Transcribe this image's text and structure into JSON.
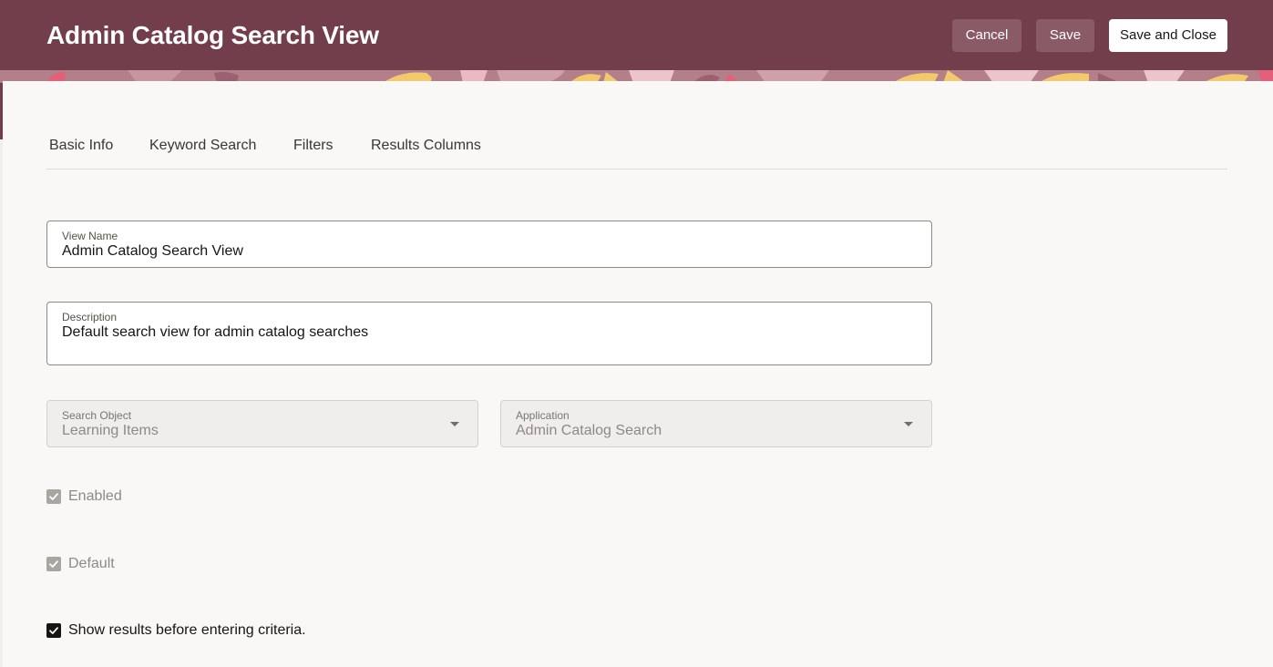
{
  "header": {
    "title": "Admin Catalog Search View",
    "cancel_label": "Cancel",
    "save_label": "Save",
    "save_close_label": "Save and Close"
  },
  "tabs": [
    {
      "label": "Basic Info"
    },
    {
      "label": "Keyword Search"
    },
    {
      "label": "Filters"
    },
    {
      "label": "Results Columns"
    }
  ],
  "form": {
    "view_name": {
      "label": "View Name",
      "value": "Admin Catalog Search View"
    },
    "description": {
      "label": "Description",
      "value": "Default search view for admin catalog searches"
    },
    "search_object": {
      "label": "Search Object",
      "value": "Learning Items"
    },
    "application": {
      "label": "Application",
      "value": "Admin Catalog Search"
    },
    "enabled": {
      "label": "Enabled",
      "checked": true
    },
    "default": {
      "label": "Default",
      "checked": true
    },
    "show_results": {
      "label": "Show results before entering criteria.",
      "checked": true
    }
  },
  "colors": {
    "header_bg": "#723e4c",
    "secondary_button": "#8a5a66",
    "panel_bg": "#f9f8f6"
  },
  "icons": [
    "chevron-down-icon",
    "checkmark-icon"
  ]
}
